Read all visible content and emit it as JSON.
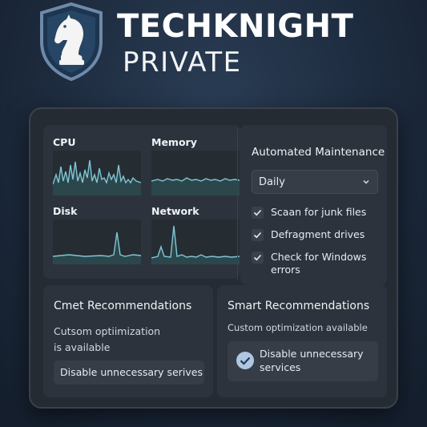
{
  "brand": {
    "title": "TECHKNIGHT",
    "subtitle": "PRIVATE",
    "logo_icon": "knight-shield-icon",
    "accent": "#7fc6d6"
  },
  "monitors": [
    {
      "label": "CPU"
    },
    {
      "label": "Memory"
    },
    {
      "label": "Disk"
    },
    {
      "label": "Network"
    }
  ],
  "maintenance": {
    "title": "Automated Maintenance",
    "schedule_value": "Daily",
    "checks": [
      {
        "label": "Scaan for junk files",
        "checked": true
      },
      {
        "label": "Defragment drives",
        "checked": true
      },
      {
        "label": "Check for Windows errors",
        "checked": true
      }
    ]
  },
  "rec_left": {
    "title": "Cmet Recommendations",
    "subtitle": "Cutsom optiimization is available",
    "action_label": "Disable unnecessary serives"
  },
  "rec_right": {
    "title": "Smart Recommendations",
    "subtitle": "Custom optimization available",
    "action_label": "Disable unnecessary services",
    "action_icon": "check-circle-icon"
  }
}
